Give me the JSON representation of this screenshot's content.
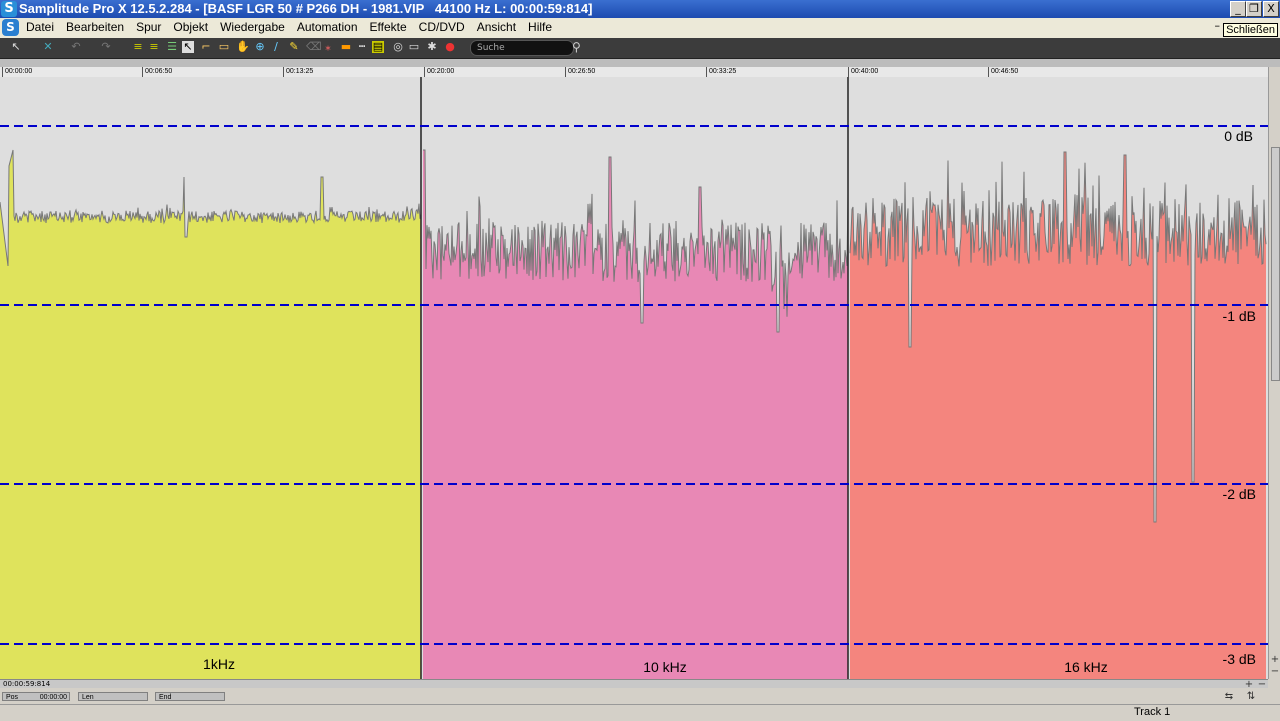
{
  "window": {
    "icon_letter": "S",
    "title": "Samplitude Pro X 12.5.2.284 - [BASF LGR 50 # P266 DH - 1981.VIP   44100 Hz L: 00:00:59:814]",
    "minimize": "_",
    "restore": "❐",
    "close": "X"
  },
  "menu": {
    "items": [
      "Datei",
      "Bearbeiten",
      "Spur",
      "Objekt",
      "Wiedergabe",
      "Automation",
      "Effekte",
      "CD/DVD",
      "Ansicht",
      "Hilfe"
    ],
    "tooltip": "Schließen",
    "mdi_dash": "–"
  },
  "toolbar": {
    "search_placeholder": "Suche",
    "search_icon": "magnifier-icon"
  },
  "ruler": {
    "ticks": [
      "00:00:00",
      "00:06:50",
      "00:13:25",
      "00:20:00",
      "00:26:50",
      "00:33:25",
      "00:40:00",
      "00:46:50"
    ]
  },
  "waveform": {
    "db_labels": [
      "0 dB",
      "-1 dB",
      "-2 dB",
      "-3 dB"
    ],
    "segments": [
      {
        "label": "1kHz",
        "color": "#dfe35c"
      },
      {
        "label": "10 kHz",
        "color": "#e888b5"
      },
      {
        "label": "16 kHz",
        "color": "#f4857e"
      }
    ],
    "background": "#dedede",
    "gridline_color": "#0000cc"
  },
  "status": {
    "position_text": "00:00:59:814",
    "pos_label": "Pos",
    "pos_value": "00:00:00",
    "len_label": "Len",
    "end_label": "End",
    "track_label": "Track 1"
  }
}
